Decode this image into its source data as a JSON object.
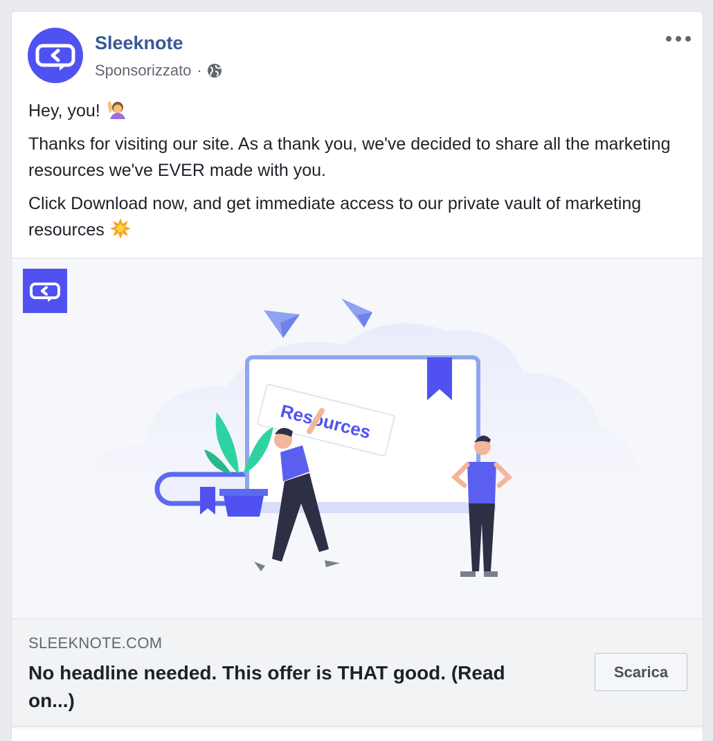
{
  "post": {
    "page_name": "Sleeknote",
    "sponsored_label": "Sponsorizzato",
    "separator": "·",
    "privacy_icon": "globe-icon",
    "more_icon": "more-options-icon"
  },
  "message": {
    "line1": "Hey, you!",
    "line1_emoji": "woman-raising-hand-emoji",
    "paragraph2": "Thanks for visiting our site. As a thank you, we've decided to share all the marketing resources we've EVER made with you.",
    "paragraph3": "Click Download now, and get immediate access to our private vault of marketing resources",
    "paragraph3_emoji": "collision-emoji"
  },
  "media": {
    "sign_text": "Resources",
    "logo_icon": "sleeknote-logo-icon"
  },
  "link": {
    "domain": "SLEEKNOTE.COM",
    "headline": "No headline needed. This offer is THAT good. (Read on...)",
    "cta_label": "Scarica"
  },
  "colors": {
    "brand": "#4f52f0",
    "link_name": "#385898",
    "accent_green": "#2ed3a1"
  }
}
